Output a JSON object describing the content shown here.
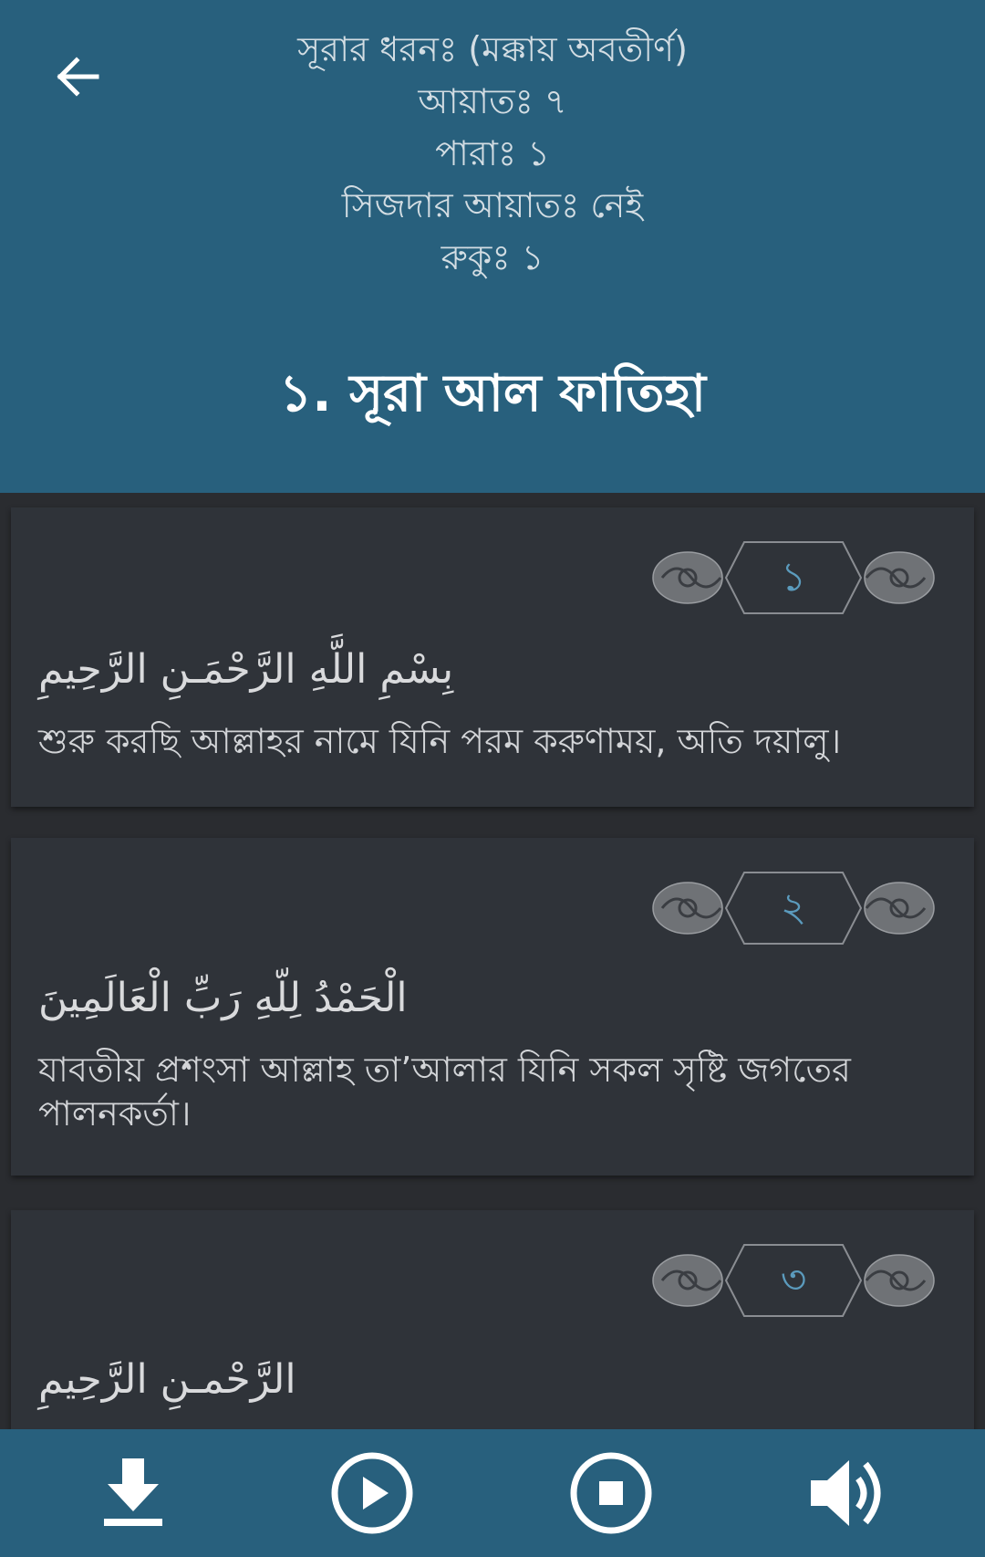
{
  "header": {
    "surah_type": "সূরার ধরনঃ (মক্কায় অবতীর্ণ)",
    "ayat_count": "আয়াতঃ ৭",
    "para": "পারাঃ ১",
    "sijdah": "সিজদার আয়াতঃ নেই",
    "ruku": "রুকুঃ ১",
    "title": "১. সূরা আল ফাতিহা"
  },
  "verses": [
    {
      "number": "১",
      "arabic": "بِسْمِ اللَّهِ الرَّحْمَـنِ الرَّحِيمِ",
      "translation": "শুরু করছি আল্লাহর নামে যিনি পরম করুণাময়, অতি দয়ালু।"
    },
    {
      "number": "২",
      "arabic": "الْحَمْدُ لِلّهِ رَبِّ الْعَالَمِينَ",
      "translation": "যাবতীয় প্রশংসা আল্লাহ তা’আলার যিনি সকল সৃষ্টি জগতের পালনকর্তা।"
    },
    {
      "number": "৩",
      "arabic": "الرَّحْمـنِ الرَّحِيمِ",
      "translation": ""
    }
  ],
  "controls": {
    "icons": [
      "download-icon",
      "play-icon",
      "stop-icon",
      "volume-icon"
    ]
  },
  "colors": {
    "header_bg": "#28607d",
    "page_bg": "#2a2c30",
    "card_bg": "#2f3339",
    "accent_number": "#5b9bbd"
  }
}
